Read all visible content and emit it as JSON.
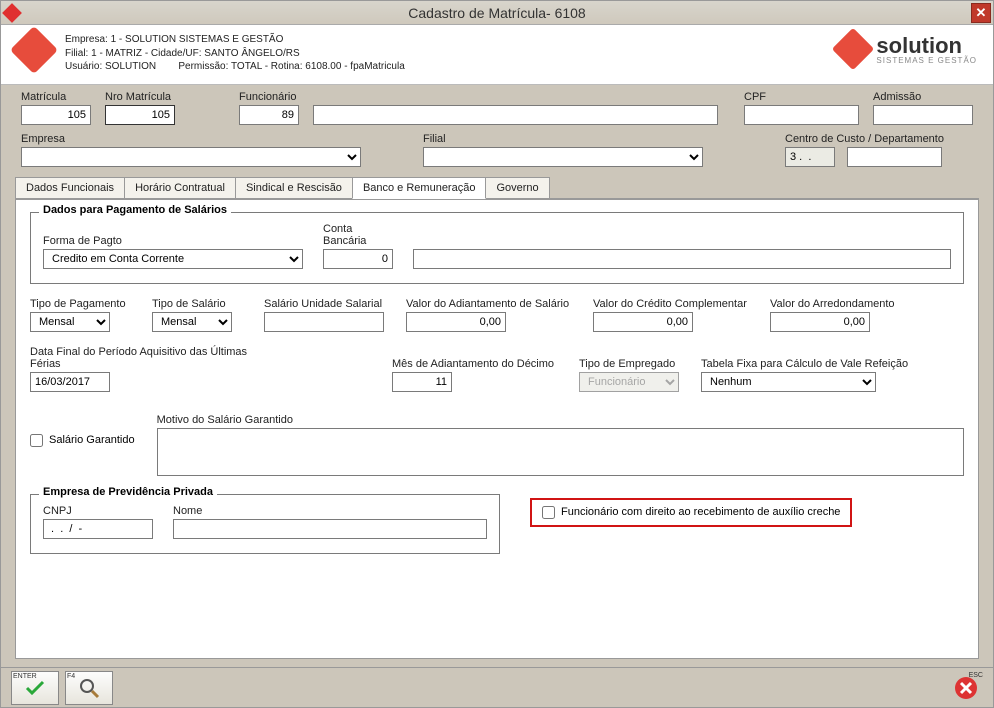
{
  "window": {
    "title": "Cadastro de Matrícula- 6108"
  },
  "header": {
    "line1": "Empresa: 1 - SOLUTION SISTEMAS E GESTÃO",
    "line2": "Filial: 1 - MATRIZ - Cidade/UF: SANTO ÂNGELO/RS",
    "usuario": "Usuário: SOLUTION",
    "permissao": "Permissão: TOTAL - Rotina: 6108.00 - fpaMatricula",
    "brand": "solution",
    "brand_sub": "SISTEMAS E GESTÃO"
  },
  "top": {
    "matricula_label": "Matrícula",
    "matricula": "105",
    "nro_label": "Nro Matrícula",
    "nro": "105",
    "func_label": "Funcionário",
    "func_code": "89",
    "func_name": "",
    "cpf_label": "CPF",
    "cpf": "",
    "admissao_label": "Admissão",
    "admissao": ""
  },
  "second": {
    "empresa_label": "Empresa",
    "empresa": "",
    "filial_label": "Filial",
    "filial": "",
    "cc_label": "Centro de Custo / Departamento",
    "cc_code": "3 .  .",
    "cc_name": ""
  },
  "tabs": {
    "t1": "Dados Funcionais",
    "t2": "Horário Contratual",
    "t3": "Sindical e Rescisão",
    "t4": "Banco e Remuneração",
    "t5": "Governo"
  },
  "pagto": {
    "group_title": "Dados para Pagamento de Salários",
    "forma_label": "Forma de Pagto",
    "forma": "Credito em Conta Corrente",
    "conta_label": "Conta Bancária",
    "conta_num": "0",
    "conta_desc": ""
  },
  "r2": {
    "tipo_pag_label": "Tipo de Pagamento",
    "tipo_pag": "Mensal",
    "tipo_sal_label": "Tipo de Salário",
    "tipo_sal": "Mensal",
    "sal_unid_label": "Salário Unidade Salarial",
    "sal_unid": "",
    "adiant_label": "Valor do Adiantamento de Salário",
    "adiant": "0,00",
    "cred_label": "Valor do Crédito Complementar",
    "cred": "0,00",
    "arred_label": "Valor do Arredondamento",
    "arred": "0,00"
  },
  "r3": {
    "dataf_label": "Data Final do Período Aquisitivo das Últimas Férias",
    "dataf": "16/03/2017",
    "mes_label": "Mês de Adiantamento do Décimo",
    "mes": "11",
    "tipoemp_label": "Tipo de Empregado",
    "tipoemp": "Funcionário",
    "tabfixa_label": "Tabela Fixa para Cálculo de Vale Refeição",
    "tabfixa": "Nenhum"
  },
  "r4": {
    "salgar_label": "Salário Garantido",
    "motivo_label": "Motivo do Salário Garantido",
    "motivo": ""
  },
  "prev": {
    "title": "Empresa de Previdência Privada",
    "cnpj_label": "CNPJ",
    "cnpj": " .  .  /  -",
    "nome_label": "Nome",
    "nome": ""
  },
  "creche_label": "Funcionário com direito ao recebimento de auxílio creche",
  "footer": {
    "enter": "ENTER",
    "f4": "F4",
    "esc": "ESC"
  }
}
